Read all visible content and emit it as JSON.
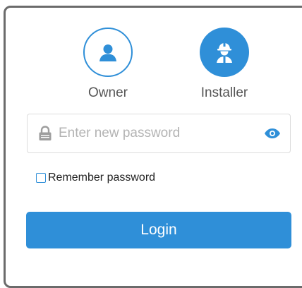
{
  "roles": [
    {
      "label": "Owner",
      "icon": "person-icon",
      "selected": false
    },
    {
      "label": "Installer",
      "icon": "worker-hardhat-icon",
      "selected": true
    }
  ],
  "password": {
    "placeholder": "Enter new password",
    "value": "",
    "lock_icon": "lock-icon",
    "eye_icon": "eye-icon"
  },
  "remember": {
    "label": "Remember password",
    "checked": false
  },
  "login": {
    "label": "Login"
  },
  "colors": {
    "accent": "#2f8fd8",
    "frame_border": "#6b6b6b",
    "field_border": "#dcdcdc",
    "placeholder": "#b3b3b3"
  }
}
